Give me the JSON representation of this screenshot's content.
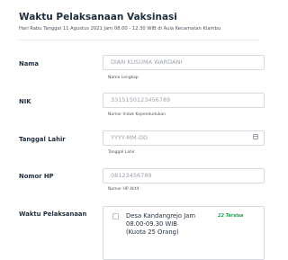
{
  "header": {
    "title": "Waktu Pelaksanaan Vaksinasi",
    "subtitle": "Hari Rabu Tanggal 11 Agustus 2021 Jam 08.00 - 12.30 WIB di Aula Kecamatan Klambu"
  },
  "form": {
    "nama": {
      "label": "Nama",
      "placeholder": "DIAN KUSUMA WARDANI",
      "help": "Nama Lengkap"
    },
    "nik": {
      "label": "NIK",
      "placeholder": "3315150123456789",
      "help": "Nomor Induk Kependudukan"
    },
    "tanggal_lahir": {
      "label": "Tanggal Lahir",
      "placeholder": "YYYY-MM-DD",
      "help": "Tanggal Lahir",
      "icon": "calendar-icon"
    },
    "nomor_hp": {
      "label": "Nomor HP",
      "placeholder": "08123456789",
      "help": "Nomor HP Aktif"
    },
    "waktu": {
      "label": "Waktu Pelaksanaan",
      "option_text": "Desa Kandangrejo Jam 08.00-09.30 WIB (Kuota 25 Orang)",
      "option_badge": "22 Tersisa"
    }
  },
  "colors": {
    "badge": "#16a34a",
    "border": "#d7dbe0",
    "title": "#1f2d3d"
  }
}
